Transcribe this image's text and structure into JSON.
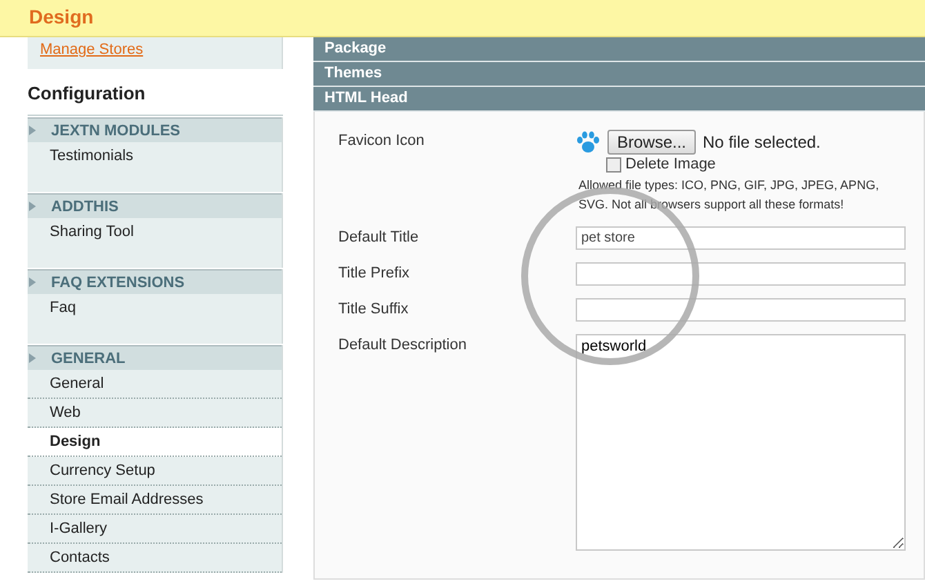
{
  "top_banner": {
    "title": "Design"
  },
  "scope": {
    "manage_link": "Manage Stores"
  },
  "sidebar": {
    "title": "Configuration",
    "groups": [
      {
        "title": "JEXTN MODULES",
        "items": [
          {
            "label": "Testimonials",
            "selected": false
          }
        ]
      },
      {
        "title": "ADDTHIS",
        "items": [
          {
            "label": "Sharing Tool",
            "selected": false
          }
        ]
      },
      {
        "title": "FAQ EXTENSIONS",
        "items": [
          {
            "label": "Faq",
            "selected": false
          }
        ]
      },
      {
        "title": "GENERAL",
        "items": [
          {
            "label": "General",
            "selected": false
          },
          {
            "label": "Web",
            "selected": false
          },
          {
            "label": "Design",
            "selected": true
          },
          {
            "label": "Currency Setup",
            "selected": false
          },
          {
            "label": "Store Email Addresses",
            "selected": false
          },
          {
            "label": "I-Gallery",
            "selected": false
          },
          {
            "label": "Contacts",
            "selected": false
          }
        ]
      }
    ]
  },
  "sections": [
    {
      "title": "Package"
    },
    {
      "title": "Themes"
    },
    {
      "title": "HTML Head"
    }
  ],
  "form": {
    "fields": [
      {
        "kind": "file",
        "label": "Favicon Icon",
        "button": "Browse...",
        "status": "No file selected.",
        "checkbox": {
          "label": "Delete Image",
          "checked": false
        },
        "note": "Allowed file types: ICO, PNG, GIF, JPG, JPEG, APNG, SVG. Not all browsers support all these formats!"
      },
      {
        "kind": "text",
        "label": "Default Title",
        "value": "pet store"
      },
      {
        "kind": "text",
        "label": "Title Prefix"
      },
      {
        "kind": "text",
        "label": "Title Suffix"
      },
      {
        "kind": "textarea",
        "label": "Default Description",
        "value": "petsworld"
      }
    ]
  }
}
